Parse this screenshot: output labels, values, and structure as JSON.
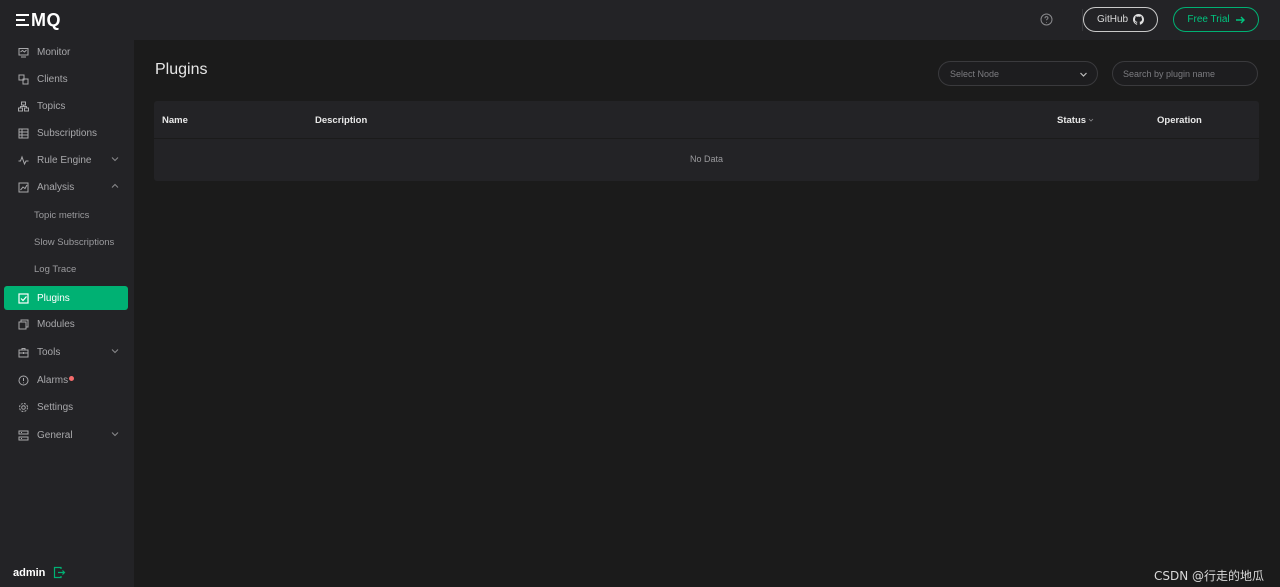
{
  "brand": {
    "name": "MQ"
  },
  "sidebar": {
    "items": [
      {
        "label": "Monitor",
        "icon": "monitor-icon"
      },
      {
        "label": "Clients",
        "icon": "clients-icon"
      },
      {
        "label": "Topics",
        "icon": "topics-icon"
      },
      {
        "label": "Subscriptions",
        "icon": "subscriptions-icon"
      },
      {
        "label": "Rule Engine",
        "icon": "rule-engine-icon",
        "expandable": true
      },
      {
        "label": "Analysis",
        "icon": "analysis-icon",
        "expanded": true
      },
      {
        "label": "Topic metrics",
        "sub": true
      },
      {
        "label": "Slow Subscriptions",
        "sub": true
      },
      {
        "label": "Log Trace",
        "sub": true
      },
      {
        "label": "Plugins",
        "icon": "plugins-icon",
        "active": true
      },
      {
        "label": "Modules",
        "icon": "modules-icon"
      },
      {
        "label": "Tools",
        "icon": "tools-icon",
        "expandable": true
      },
      {
        "label": "Alarms",
        "icon": "alarms-icon",
        "badge": true
      },
      {
        "label": "Settings",
        "icon": "settings-icon"
      },
      {
        "label": "General",
        "icon": "general-icon",
        "expandable": true
      }
    ],
    "user": "admin"
  },
  "topbar": {
    "github_label": "GitHub",
    "trial_label": "Free Trial"
  },
  "main": {
    "title": "Plugins",
    "select_node_placeholder": "Select Node",
    "search_placeholder": "Search by plugin name",
    "table": {
      "columns": [
        "Name",
        "Description",
        "Status",
        "Operation"
      ],
      "empty_text": "No Data"
    }
  },
  "watermark": "CSDN @行走的地瓜",
  "colors": {
    "accent": "#00b173",
    "background": "#1b1b1b",
    "sidebar": "#232326",
    "alarm": "#f56c6c"
  }
}
